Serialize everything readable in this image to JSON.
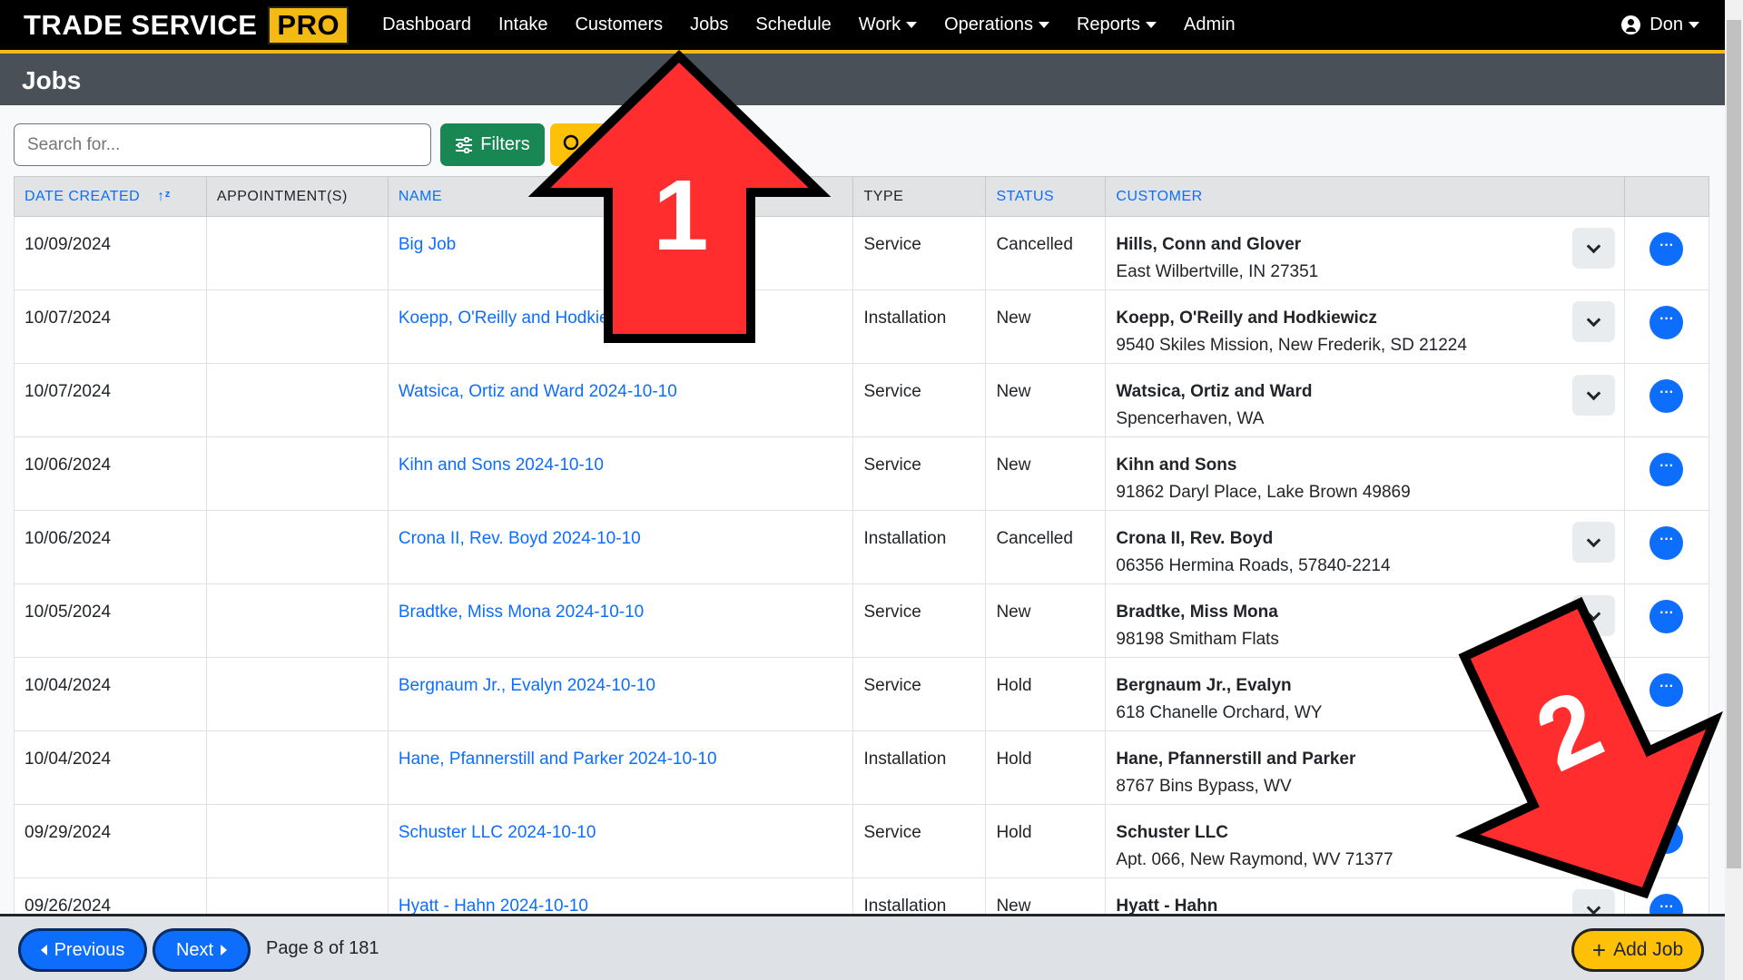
{
  "brand": {
    "name": "TRADE SERVICE",
    "badge": "PRO"
  },
  "nav": [
    {
      "label": "Dashboard",
      "dropdown": false
    },
    {
      "label": "Intake",
      "dropdown": false
    },
    {
      "label": "Customers",
      "dropdown": false
    },
    {
      "label": "Jobs",
      "dropdown": false
    },
    {
      "label": "Schedule",
      "dropdown": false
    },
    {
      "label": "Work",
      "dropdown": true
    },
    {
      "label": "Operations",
      "dropdown": true
    },
    {
      "label": "Reports",
      "dropdown": true
    },
    {
      "label": "Admin",
      "dropdown": false
    }
  ],
  "user": {
    "name": "Don",
    "icon": "user-circle-icon"
  },
  "page_title": "Jobs",
  "toolbar": {
    "search_placeholder": "Search for...",
    "filters_label": "Filters",
    "search_icon": "search-icon"
  },
  "table": {
    "columns": [
      {
        "label": "DATE CREATED",
        "sortable": true,
        "sorted": true
      },
      {
        "label": "APPOINTMENT(S)",
        "sortable": false
      },
      {
        "label": "NAME",
        "sortable": true
      },
      {
        "label": "TYPE",
        "sortable": false
      },
      {
        "label": "STATUS",
        "sortable": true
      },
      {
        "label": "CUSTOMER",
        "sortable": true
      },
      {
        "label": ""
      }
    ],
    "rows": [
      {
        "date": "10/09/2024",
        "appointments": "",
        "name": "Big Job",
        "type": "Service",
        "status": "Cancelled",
        "customer": "Hills, Conn and Glover",
        "address": "East Wilbertville, IN 27351",
        "toggle": true
      },
      {
        "date": "10/07/2024",
        "appointments": "",
        "name": "Koepp, O'Reilly and Hodkiewicz 2024-10-10",
        "type": "Installation",
        "status": "New",
        "customer": "Koepp, O'Reilly and Hodkiewicz",
        "address": "9540 Skiles Mission, New Frederik, SD 21224",
        "toggle": true
      },
      {
        "date": "10/07/2024",
        "appointments": "",
        "name": "Watsica, Ortiz and Ward 2024-10-10",
        "type": "Service",
        "status": "New",
        "customer": "Watsica, Ortiz and Ward",
        "address": "Spencerhaven, WA",
        "toggle": true
      },
      {
        "date": "10/06/2024",
        "appointments": "",
        "name": "Kihn and Sons 2024-10-10",
        "type": "Service",
        "status": "New",
        "customer": "Kihn and Sons",
        "address": "91862 Daryl Place, Lake Brown 49869",
        "toggle": false
      },
      {
        "date": "10/06/2024",
        "appointments": "",
        "name": "Crona II, Rev. Boyd 2024-10-10",
        "type": "Installation",
        "status": "Cancelled",
        "customer": "Crona II, Rev. Boyd",
        "address": "06356 Hermina Roads, 57840-2214",
        "toggle": true
      },
      {
        "date": "10/05/2024",
        "appointments": "",
        "name": "Bradtke, Miss Mona 2024-10-10",
        "type": "Service",
        "status": "New",
        "customer": "Bradtke, Miss Mona",
        "address": "98198 Smitham Flats",
        "toggle": true
      },
      {
        "date": "10/04/2024",
        "appointments": "",
        "name": "Bergnaum Jr., Evalyn 2024-10-10",
        "type": "Service",
        "status": "Hold",
        "customer": "Bergnaum Jr., Evalyn",
        "address": "618 Chanelle Orchard, WY",
        "toggle": true
      },
      {
        "date": "10/04/2024",
        "appointments": "",
        "name": "Hane, Pfannerstill and Parker 2024-10-10",
        "type": "Installation",
        "status": "Hold",
        "customer": "Hane, Pfannerstill and Parker",
        "address": "8767 Bins Bypass, WV",
        "toggle": true
      },
      {
        "date": "09/29/2024",
        "appointments": "",
        "name": "Schuster LLC 2024-10-10",
        "type": "Service",
        "status": "Hold",
        "customer": "Schuster LLC",
        "address": "Apt. 066, New Raymond, WV 71377",
        "toggle": true
      },
      {
        "date": "09/26/2024",
        "appointments": "",
        "name": "Hyatt - Hahn 2024-10-10",
        "type": "Installation",
        "status": "New",
        "customer": "Hyatt - Hahn",
        "address": "",
        "toggle": true
      }
    ]
  },
  "pagination": {
    "previous": "Previous",
    "next": "Next",
    "info": "Page 8 of 181",
    "current": 8,
    "total": 181
  },
  "add_job_label": "Add Job",
  "annotations": [
    {
      "label": "1",
      "color": "#ff2d2d"
    },
    {
      "label": "2",
      "color": "#ff2d2d"
    }
  ],
  "colors": {
    "accent": "#f5b913",
    "link": "#0d6efd",
    "filters": "#198754",
    "add": "#ffc107"
  }
}
